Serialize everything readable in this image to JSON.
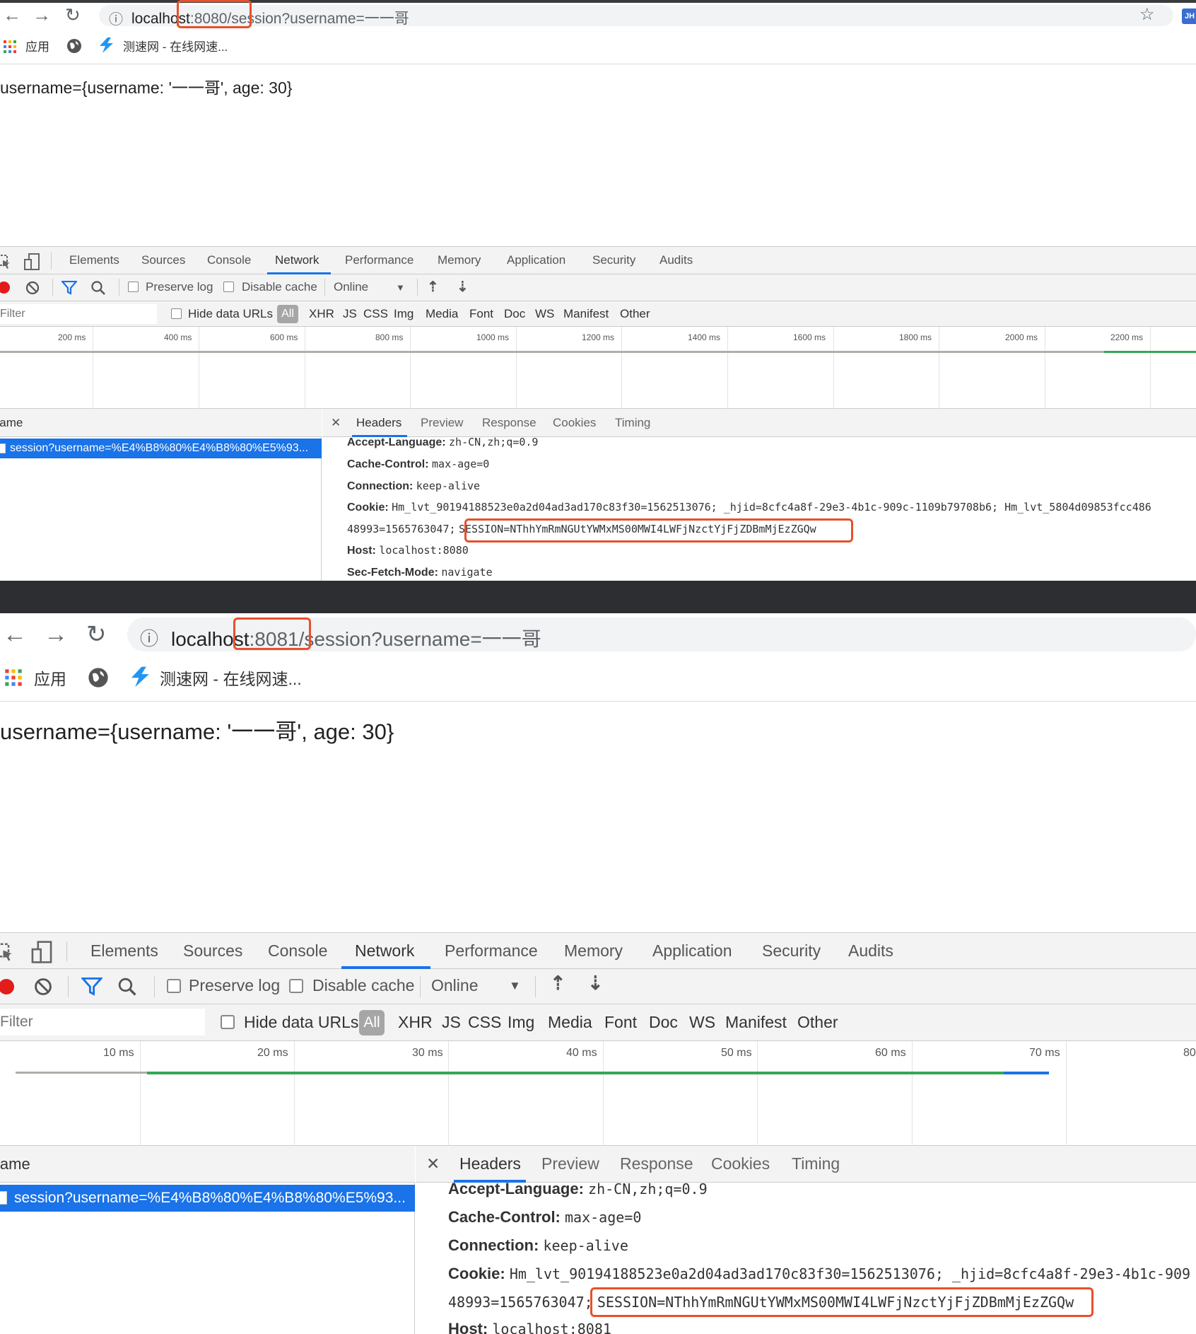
{
  "panel1": {
    "nav": {
      "back": "←",
      "forward": "→",
      "reload": "↻"
    },
    "url": {
      "host": "localhost",
      "rest": ":8080/session?username=一一哥"
    },
    "bookmarks": {
      "apps": "应用",
      "site": "测速网 - 在线网速..."
    },
    "page_text": "username={username: '一一哥', age: 30}",
    "devtools_tabs": [
      "Elements",
      "Sources",
      "Console",
      "Network",
      "Performance",
      "Memory",
      "Application",
      "Security",
      "Audits"
    ],
    "toolbar": {
      "preserve_log": "Preserve log",
      "disable_cache": "Disable cache",
      "throttle": "Online",
      "upload": "⇡",
      "download": "⇣"
    },
    "filter": {
      "placeholder": "Filter",
      "hide_data_urls": "Hide data URLs",
      "all": "All",
      "types": [
        "XHR",
        "JS",
        "CSS",
        "Img",
        "Media",
        "Font",
        "Doc",
        "WS",
        "Manifest",
        "Other"
      ]
    },
    "timeline_ticks": [
      "200 ms",
      "400 ms",
      "600 ms",
      "800 ms",
      "1000 ms",
      "1200 ms",
      "1400 ms",
      "1600 ms",
      "1800 ms",
      "2000 ms",
      "2200 ms"
    ],
    "reqlist": {
      "header": "Name",
      "row": "session?username=%E4%B8%80%E4%B8%80%E5%93..."
    },
    "detail_tabs": [
      "Headers",
      "Preview",
      "Response",
      "Cookies",
      "Timing"
    ],
    "headers": [
      {
        "k": "Accept-Language:",
        "v": "zh-CN,zh;q=0.9"
      },
      {
        "k": "Cache-Control:",
        "v": "max-age=0"
      },
      {
        "k": "Connection:",
        "v": "keep-alive"
      },
      {
        "k": "Cookie:",
        "v": "Hm_lvt_90194188523e0a2d04ad3ad170c83f30=1562513076; _hjid=8cfc4a8f-29e3-4b1c-909c-1109b79708b6; Hm_lvt_5804d09853fcc486"
      },
      {
        "k": "",
        "v": "48993=1565763047;"
      },
      {
        "k": "Host:",
        "v": "localhost:8080"
      },
      {
        "k": "Sec-Fetch-Mode:",
        "v": "navigate"
      }
    ],
    "session": "SESSION=NThhYmRmNGUtYWMxMS00MWI4LWFjNzctYjFjZDBmMjEzZGQw"
  },
  "panel2": {
    "nav": {
      "back": "←",
      "forward": "→",
      "reload": "↻"
    },
    "url": {
      "host": "localhost",
      "rest": ":8081/session?username=一一哥"
    },
    "bookmarks": {
      "apps": "应用",
      "site": "测速网 - 在线网速..."
    },
    "page_text": "username={username: '一一哥', age: 30}",
    "devtools_tabs": [
      "Elements",
      "Sources",
      "Console",
      "Network",
      "Performance",
      "Memory",
      "Application",
      "Security",
      "Audits"
    ],
    "toolbar": {
      "preserve_log": "Preserve log",
      "disable_cache": "Disable cache",
      "throttle": "Online",
      "upload": "⇡",
      "download": "⇣"
    },
    "filter": {
      "placeholder": "Filter",
      "hide_data_urls": "Hide data URLs",
      "all": "All",
      "types": [
        "XHR",
        "JS",
        "CSS",
        "Img",
        "Media",
        "Font",
        "Doc",
        "WS",
        "Manifest",
        "Other"
      ]
    },
    "timeline_ticks": [
      "10 ms",
      "20 ms",
      "30 ms",
      "40 ms",
      "50 ms",
      "60 ms",
      "70 ms",
      "80"
    ],
    "reqlist": {
      "header": "Name",
      "row": "session?username=%E4%B8%80%E4%B8%80%E5%93..."
    },
    "detail_tabs": [
      "Headers",
      "Preview",
      "Response",
      "Cookies",
      "Timing"
    ],
    "headers": [
      {
        "k": "Accept-Language:",
        "v": "zh-CN,zh;q=0.9"
      },
      {
        "k": "Cache-Control:",
        "v": "max-age=0"
      },
      {
        "k": "Connection:",
        "v": "keep-alive"
      },
      {
        "k": "Cookie:",
        "v": "Hm_lvt_90194188523e0a2d04ad3ad170c83f30=1562513076; _hjid=8cfc4a8f-29e3-4b1c-909"
      },
      {
        "k": "",
        "v": "48993=1565763047;"
      },
      {
        "k": "Host:",
        "v": "localhost:8081"
      }
    ],
    "session": "SESSION=NThhYmRmNGUtYWMxMS00MWI4LWFjNzctYjFjZDBmMjEzZGQw"
  },
  "colors": {
    "accent_blue": "#1a73e8",
    "highlight_red": "#e8502b",
    "record_red": "#e21b1b",
    "timeline_green": "#34a853"
  }
}
